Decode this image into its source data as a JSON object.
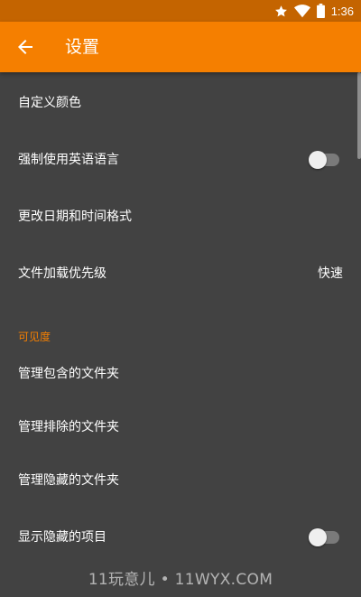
{
  "status_bar": {
    "time": "1:36",
    "icons": [
      "star-icon",
      "wifi-icon",
      "battery-icon"
    ]
  },
  "app_bar": {
    "title": "设置",
    "back_icon": "arrow-left-icon"
  },
  "settings": {
    "customize_colors": {
      "label": "自定义颜色"
    },
    "force_english": {
      "label": "强制使用英语语言",
      "toggle_on": false
    },
    "date_time_format": {
      "label": "更改日期和时间格式"
    },
    "file_loading_priority": {
      "label": "文件加载优先级",
      "value": "快速"
    }
  },
  "visibility": {
    "header": "可见度",
    "manage_included_folders": {
      "label": "管理包含的文件夹"
    },
    "manage_excluded_folders": {
      "label": "管理排除的文件夹"
    },
    "manage_hidden_folders": {
      "label": "管理隐藏的文件夹"
    },
    "show_hidden_items": {
      "label": "显示隐藏的项目",
      "toggle_on": false
    }
  },
  "watermark": "11玩意儿 • 11WYX.COM",
  "colors": {
    "primary": "#f57f00",
    "status_bar": "#c46400",
    "background": "#424242",
    "text": "#ffffff"
  }
}
